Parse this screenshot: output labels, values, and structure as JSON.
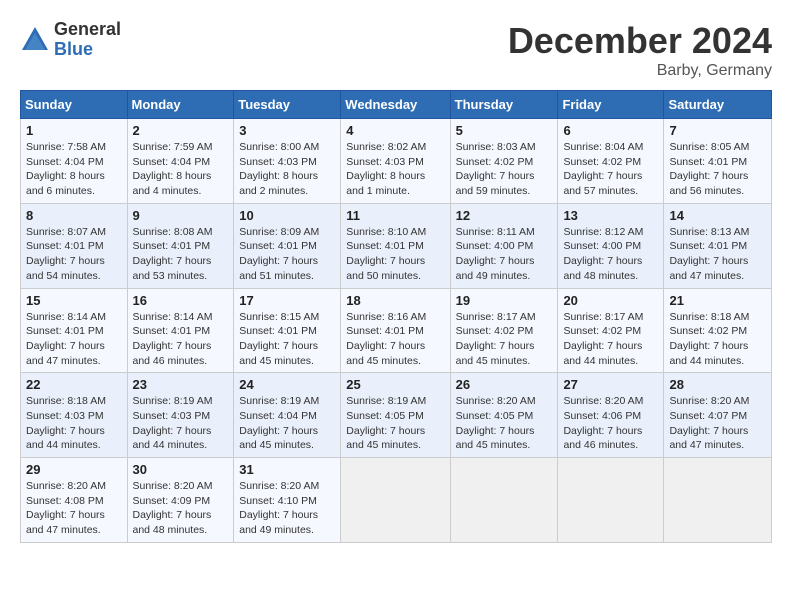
{
  "header": {
    "logo_general": "General",
    "logo_blue": "Blue",
    "title": "December 2024",
    "location": "Barby, Germany"
  },
  "weekdays": [
    "Sunday",
    "Monday",
    "Tuesday",
    "Wednesday",
    "Thursday",
    "Friday",
    "Saturday"
  ],
  "weeks": [
    [
      {
        "day": "1",
        "lines": [
          "Sunrise: 7:58 AM",
          "Sunset: 4:04 PM",
          "Daylight: 8 hours",
          "and 6 minutes."
        ]
      },
      {
        "day": "2",
        "lines": [
          "Sunrise: 7:59 AM",
          "Sunset: 4:04 PM",
          "Daylight: 8 hours",
          "and 4 minutes."
        ]
      },
      {
        "day": "3",
        "lines": [
          "Sunrise: 8:00 AM",
          "Sunset: 4:03 PM",
          "Daylight: 8 hours",
          "and 2 minutes."
        ]
      },
      {
        "day": "4",
        "lines": [
          "Sunrise: 8:02 AM",
          "Sunset: 4:03 PM",
          "Daylight: 8 hours",
          "and 1 minute."
        ]
      },
      {
        "day": "5",
        "lines": [
          "Sunrise: 8:03 AM",
          "Sunset: 4:02 PM",
          "Daylight: 7 hours",
          "and 59 minutes."
        ]
      },
      {
        "day": "6",
        "lines": [
          "Sunrise: 8:04 AM",
          "Sunset: 4:02 PM",
          "Daylight: 7 hours",
          "and 57 minutes."
        ]
      },
      {
        "day": "7",
        "lines": [
          "Sunrise: 8:05 AM",
          "Sunset: 4:01 PM",
          "Daylight: 7 hours",
          "and 56 minutes."
        ]
      }
    ],
    [
      {
        "day": "8",
        "lines": [
          "Sunrise: 8:07 AM",
          "Sunset: 4:01 PM",
          "Daylight: 7 hours",
          "and 54 minutes."
        ]
      },
      {
        "day": "9",
        "lines": [
          "Sunrise: 8:08 AM",
          "Sunset: 4:01 PM",
          "Daylight: 7 hours",
          "and 53 minutes."
        ]
      },
      {
        "day": "10",
        "lines": [
          "Sunrise: 8:09 AM",
          "Sunset: 4:01 PM",
          "Daylight: 7 hours",
          "and 51 minutes."
        ]
      },
      {
        "day": "11",
        "lines": [
          "Sunrise: 8:10 AM",
          "Sunset: 4:01 PM",
          "Daylight: 7 hours",
          "and 50 minutes."
        ]
      },
      {
        "day": "12",
        "lines": [
          "Sunrise: 8:11 AM",
          "Sunset: 4:00 PM",
          "Daylight: 7 hours",
          "and 49 minutes."
        ]
      },
      {
        "day": "13",
        "lines": [
          "Sunrise: 8:12 AM",
          "Sunset: 4:00 PM",
          "Daylight: 7 hours",
          "and 48 minutes."
        ]
      },
      {
        "day": "14",
        "lines": [
          "Sunrise: 8:13 AM",
          "Sunset: 4:01 PM",
          "Daylight: 7 hours",
          "and 47 minutes."
        ]
      }
    ],
    [
      {
        "day": "15",
        "lines": [
          "Sunrise: 8:14 AM",
          "Sunset: 4:01 PM",
          "Daylight: 7 hours",
          "and 47 minutes."
        ]
      },
      {
        "day": "16",
        "lines": [
          "Sunrise: 8:14 AM",
          "Sunset: 4:01 PM",
          "Daylight: 7 hours",
          "and 46 minutes."
        ]
      },
      {
        "day": "17",
        "lines": [
          "Sunrise: 8:15 AM",
          "Sunset: 4:01 PM",
          "Daylight: 7 hours",
          "and 45 minutes."
        ]
      },
      {
        "day": "18",
        "lines": [
          "Sunrise: 8:16 AM",
          "Sunset: 4:01 PM",
          "Daylight: 7 hours",
          "and 45 minutes."
        ]
      },
      {
        "day": "19",
        "lines": [
          "Sunrise: 8:17 AM",
          "Sunset: 4:02 PM",
          "Daylight: 7 hours",
          "and 45 minutes."
        ]
      },
      {
        "day": "20",
        "lines": [
          "Sunrise: 8:17 AM",
          "Sunset: 4:02 PM",
          "Daylight: 7 hours",
          "and 44 minutes."
        ]
      },
      {
        "day": "21",
        "lines": [
          "Sunrise: 8:18 AM",
          "Sunset: 4:02 PM",
          "Daylight: 7 hours",
          "and 44 minutes."
        ]
      }
    ],
    [
      {
        "day": "22",
        "lines": [
          "Sunrise: 8:18 AM",
          "Sunset: 4:03 PM",
          "Daylight: 7 hours",
          "and 44 minutes."
        ]
      },
      {
        "day": "23",
        "lines": [
          "Sunrise: 8:19 AM",
          "Sunset: 4:03 PM",
          "Daylight: 7 hours",
          "and 44 minutes."
        ]
      },
      {
        "day": "24",
        "lines": [
          "Sunrise: 8:19 AM",
          "Sunset: 4:04 PM",
          "Daylight: 7 hours",
          "and 45 minutes."
        ]
      },
      {
        "day": "25",
        "lines": [
          "Sunrise: 8:19 AM",
          "Sunset: 4:05 PM",
          "Daylight: 7 hours",
          "and 45 minutes."
        ]
      },
      {
        "day": "26",
        "lines": [
          "Sunrise: 8:20 AM",
          "Sunset: 4:05 PM",
          "Daylight: 7 hours",
          "and 45 minutes."
        ]
      },
      {
        "day": "27",
        "lines": [
          "Sunrise: 8:20 AM",
          "Sunset: 4:06 PM",
          "Daylight: 7 hours",
          "and 46 minutes."
        ]
      },
      {
        "day": "28",
        "lines": [
          "Sunrise: 8:20 AM",
          "Sunset: 4:07 PM",
          "Daylight: 7 hours",
          "and 47 minutes."
        ]
      }
    ],
    [
      {
        "day": "29",
        "lines": [
          "Sunrise: 8:20 AM",
          "Sunset: 4:08 PM",
          "Daylight: 7 hours",
          "and 47 minutes."
        ]
      },
      {
        "day": "30",
        "lines": [
          "Sunrise: 8:20 AM",
          "Sunset: 4:09 PM",
          "Daylight: 7 hours",
          "and 48 minutes."
        ]
      },
      {
        "day": "31",
        "lines": [
          "Sunrise: 8:20 AM",
          "Sunset: 4:10 PM",
          "Daylight: 7 hours",
          "and 49 minutes."
        ]
      },
      null,
      null,
      null,
      null
    ]
  ]
}
